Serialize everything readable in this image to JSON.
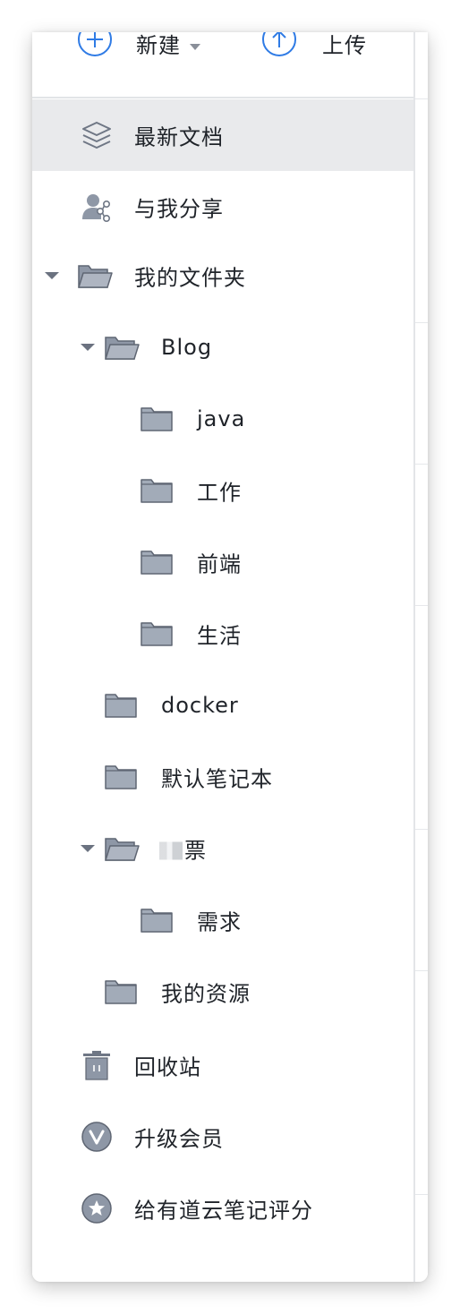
{
  "toolbar": {
    "new_label": "新建",
    "upload_label": "上传"
  },
  "nav": {
    "recent": "最新文档",
    "shared": "与我分享",
    "my_folders": "我的文件夹",
    "trash": "回收站",
    "upgrade": "升级会员",
    "rate": "给有道云笔记评分"
  },
  "folders": {
    "blog": "Blog",
    "java": "java",
    "work": "工作",
    "frontend": "前端",
    "life": "生活",
    "docker": "docker",
    "default_notebook": "默认笔记本",
    "tickets": "票",
    "requirements": "需求",
    "my_resources": "我的资源"
  },
  "colors": {
    "accent": "#2f7be5",
    "icon_gray": "#8e97a6",
    "active_bg": "#e9eaec",
    "text": "#1f2329"
  },
  "icons": {
    "new": "plus-circle-icon",
    "upload": "upload-arrow-icon",
    "recent": "layers-icon",
    "shared": "user-share-icon",
    "folder": "folder-icon",
    "folder_open": "folder-open-icon",
    "trash": "trash-icon",
    "upgrade": "vip-badge-icon",
    "rate": "star-badge-icon"
  }
}
